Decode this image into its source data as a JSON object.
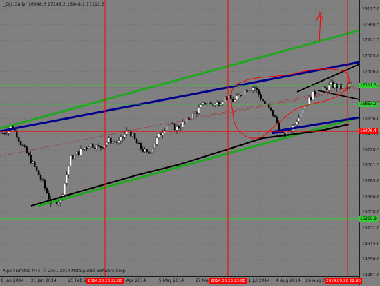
{
  "header": {
    "symbol_period": "_DJ1,Daily",
    "ohlc": "16948.6 17148.2 16948.1 17111.3"
  },
  "copyright": "Alpari Limited MT4, © 2001-2014 MetaQuotes Software Corp.",
  "price_axis": {
    "labels": [
      "18177.0",
      "17960.5",
      "17741.5",
      "17525.0",
      "17306.0",
      "17089.5",
      "16870.5",
      "16656.0",
      "16435.0",
      "16220.5",
      "16001.5",
      "15785.0",
      "15566.0",
      "15350.0",
      "15131.0",
      "14915.0",
      "14696.0",
      "14481.0"
    ]
  },
  "price_tags": [
    {
      "text": "17111.3",
      "price": 17111.3,
      "bg": "#32cd32",
      "color": "#000000"
    },
    {
      "text": "16853.2",
      "price": 16853.2,
      "bg": "#32cd32",
      "color": "#000000"
    },
    {
      "text": "16476.4",
      "price": 16476.4,
      "bg": "#ff0000",
      "color": "#ffffff"
    },
    {
      "text": "15260.9",
      "price": 15260.9,
      "bg": "#32cd32",
      "color": "#000000"
    }
  ],
  "time_axis": {
    "labels": [
      "8 Jan 2014",
      "31 Jan 2014",
      "25 Feb 2014",
      "20 Apr 2014",
      "5 May 2014",
      "27 May 2014",
      "1 Jul 2014",
      "4 Aug 2014",
      "26 Aug 2014"
    ]
  },
  "vline_tags": [
    "2014.03.28 22:00",
    "2014.06.23 23:00",
    "2014.09.26 22:00"
  ],
  "colors": {
    "background": "#808080",
    "grid": "#6b6b6b",
    "bull": "#ffffff",
    "bear": "#000000",
    "support_resistance": "#ff0000",
    "green_line": "#32cd32",
    "trend_green": "#1fa81f",
    "trend_blue": "#00008b",
    "trend_black": "#000000",
    "ma": "#8b1a1a"
  },
  "chart_data": {
    "type": "candlestick",
    "title": "_DJ1,Daily",
    "ylim": [
      14481,
      18177
    ],
    "x": [
      "8 Jan 2014",
      "31 Jan 2014",
      "25 Feb 2014",
      "20 Apr 2014",
      "5 May 2014",
      "27 May 2014",
      "1 Jul 2014",
      "4 Aug 2014",
      "26 Aug 2014"
    ],
    "approx_close": [
      16450,
      16550,
      16280,
      16050,
      15800,
      15480,
      15520,
      16100,
      16200,
      16300,
      16250,
      16350,
      16320,
      16500,
      16280,
      16150,
      16380,
      16580,
      16520,
      16620,
      16750,
      16880,
      16850,
      16950,
      16900,
      17050,
      17100,
      16880,
      16700,
      16400,
      16550,
      16800,
      16980,
      17050,
      17120,
      17080,
      17111
    ],
    "horizontal_levels": [
      17111.3,
      16853.2,
      16476.4,
      15260.9
    ]
  }
}
